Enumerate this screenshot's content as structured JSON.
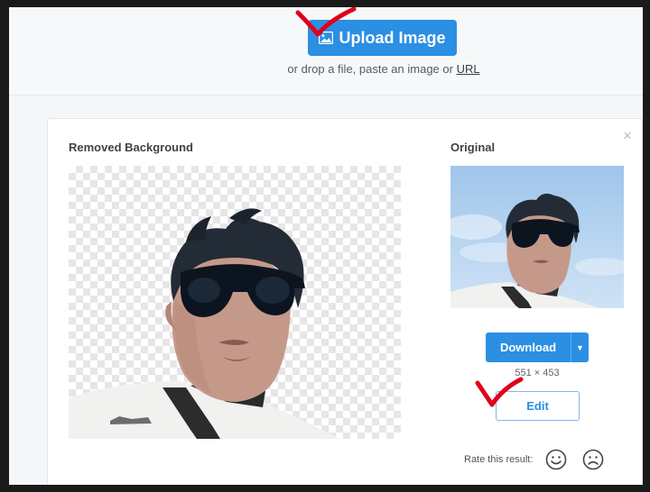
{
  "top": {
    "upload_label": "Upload Image",
    "drop_prefix": "or drop a file, paste an image or ",
    "drop_link": "URL"
  },
  "result": {
    "removed_heading": "Removed Background",
    "original_heading": "Original",
    "close_glyph": "×",
    "download_label": "Download",
    "dimensions": "551 × 453",
    "edit_label": "Edit",
    "rate_label": "Rate this result:"
  },
  "icons": [
    "image-icon",
    "close-icon",
    "chevron-down-icon",
    "smile-icon",
    "frown-icon"
  ],
  "colors": {
    "accent": "#2b8fe3",
    "annotation": "#e0001b"
  }
}
